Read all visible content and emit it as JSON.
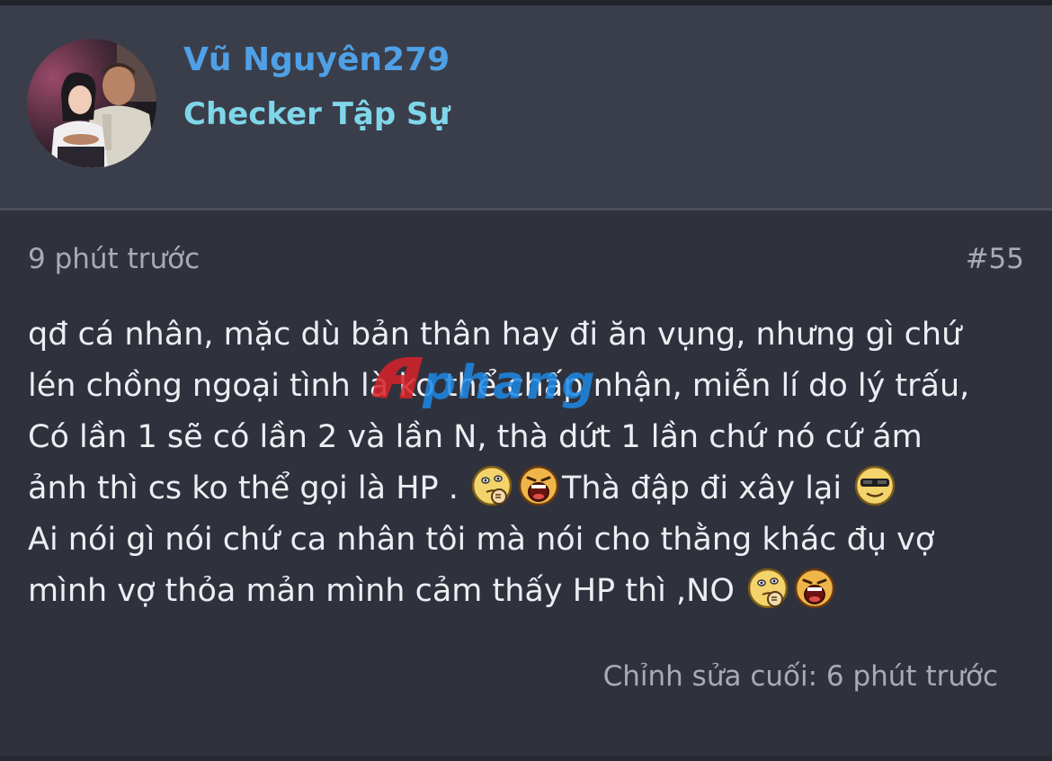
{
  "user": {
    "name": "Vũ Nguyên279",
    "title": "Checker Tập Sự",
    "avatar": "avatar-photo"
  },
  "post": {
    "time": "9 phút trước",
    "number": "#55",
    "lines": [
      [
        "qđ cá nhân, mặc dù bản thân hay đi ăn vụng, nhưng gì chứ"
      ],
      [
        "lén chồng ngoại tình là ko thể chấp nhận, miễn lí do lý trấu,"
      ],
      [
        "Có lần 1 sẽ có lần 2 và lần N, thà dứt 1 lần chứ nó cứ ám"
      ],
      [
        "ảnh thì cs ko thể gọi là HP . ",
        "Thà đập đi xây lại "
      ],
      [
        "Ai nói gì nói chứ ca nhân tôi mà nói cho thằng khác đụ vợ"
      ],
      [
        "mình vợ thỏa mản mình cảm thấy HP thì ,NO "
      ]
    ],
    "edited": "Chỉnh sửa cuối: 6 phút trước"
  },
  "emojis": {
    "line4": [
      "thinking-emoji",
      "laughing-emoji",
      "cool-emoji"
    ],
    "line6": [
      "thinking-emoji",
      "laughing-emoji"
    ]
  },
  "watermark": {
    "text": "aphang"
  },
  "colors": {
    "background": "#2f323c",
    "header_background": "#3a3e4a",
    "username": "#4fa0e6",
    "user_title": "#7fd6ea",
    "meta_text": "#a8abb3",
    "body_text": "#eceef2"
  }
}
